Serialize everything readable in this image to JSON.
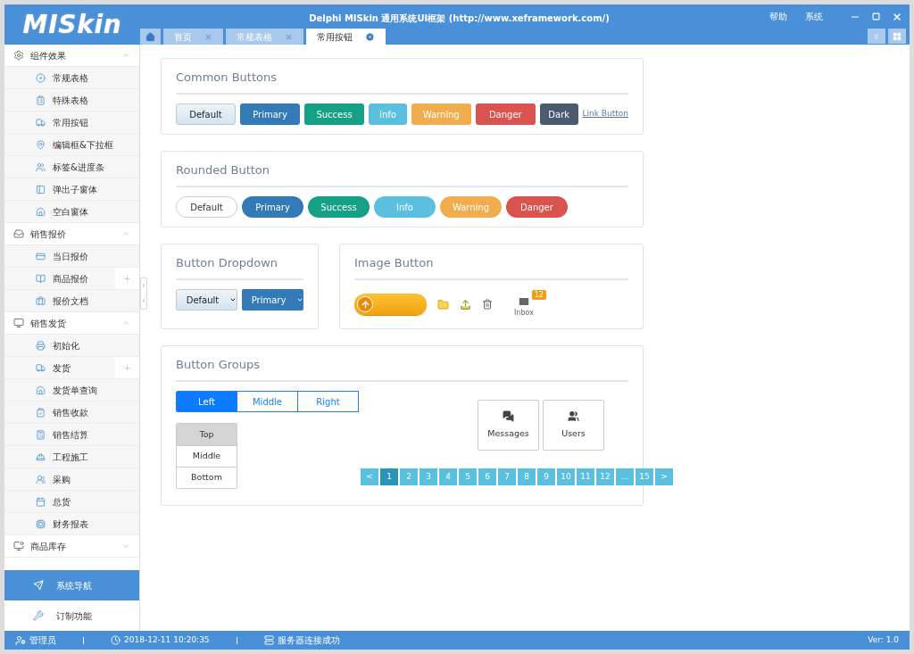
{
  "window": {
    "logo": "MISkin",
    "title": "Delphi MISkin 通用系统UI框架 (http://www.xeframework.com/)",
    "menu": [
      "帮助",
      "系统"
    ]
  },
  "tabs": [
    {
      "label": "首页",
      "selected": false
    },
    {
      "label": "常规表格",
      "selected": false
    },
    {
      "label": "常用按钮",
      "selected": true
    }
  ],
  "sidebar": {
    "groups": [
      {
        "label": "组件效果",
        "expanded": true,
        "items": [
          {
            "label": "常规表格",
            "addable": false
          },
          {
            "label": "特殊表格",
            "addable": false
          },
          {
            "label": "常用按钮",
            "addable": false
          },
          {
            "label": "编辑框&下拉框",
            "addable": false
          },
          {
            "label": "标签&进度条",
            "addable": false
          },
          {
            "label": "弹出子窗体",
            "addable": false
          },
          {
            "label": "空白窗体",
            "addable": false
          }
        ]
      },
      {
        "label": "销售报价",
        "expanded": true,
        "items": [
          {
            "label": "当日报价",
            "addable": false
          },
          {
            "label": "商品报价",
            "addable": true
          },
          {
            "label": "报价文档",
            "addable": false
          }
        ]
      },
      {
        "label": "销售发货",
        "expanded": true,
        "items": [
          {
            "label": "初始化",
            "addable": false
          },
          {
            "label": "发货",
            "addable": true
          },
          {
            "label": "发货单查询",
            "addable": false
          },
          {
            "label": "销售收款",
            "addable": false
          },
          {
            "label": "销售结算",
            "addable": false
          },
          {
            "label": "工程施工",
            "addable": false
          },
          {
            "label": "采购",
            "addable": false
          },
          {
            "label": "总货",
            "addable": false
          },
          {
            "label": "财务报表",
            "addable": false
          }
        ]
      },
      {
        "label": "商品库存",
        "expanded": false
      }
    ],
    "nav": [
      {
        "label": "系统导航",
        "selected": true
      },
      {
        "label": "订制功能",
        "selected": false
      }
    ]
  },
  "common_buttons": {
    "title": "Common Buttons",
    "buttons": [
      {
        "label": "Default",
        "kind": "default"
      },
      {
        "label": "Primary",
        "kind": "primary"
      },
      {
        "label": "Success",
        "kind": "success"
      },
      {
        "label": "Info",
        "kind": "info"
      },
      {
        "label": "Warning",
        "kind": "warning"
      },
      {
        "label": "Danger",
        "kind": "danger"
      },
      {
        "label": "Dark",
        "kind": "dark"
      },
      {
        "label": "Link Button",
        "kind": "link"
      }
    ]
  },
  "rounded_buttons": {
    "title": "Rounded Button",
    "buttons": [
      {
        "label": "Default",
        "kind": "outline"
      },
      {
        "label": "Primary",
        "kind": "primary"
      },
      {
        "label": "Success",
        "kind": "success"
      },
      {
        "label": "Info",
        "kind": "info"
      },
      {
        "label": "Warning",
        "kind": "warning"
      },
      {
        "label": "Danger",
        "kind": "danger"
      }
    ]
  },
  "button_dropdown": {
    "title": "Button Dropdown",
    "buttons": [
      {
        "label": "Default",
        "kind": "default"
      },
      {
        "label": "Primary",
        "kind": "primary"
      }
    ]
  },
  "image_button": {
    "title": "Image Button",
    "inbox": {
      "label": "Inbox",
      "count": "12"
    }
  },
  "button_groups": {
    "title": "Button Groups",
    "horizontal": [
      {
        "label": "Left",
        "selected": true
      },
      {
        "label": "Middle",
        "selected": false
      },
      {
        "label": "Right",
        "selected": false
      }
    ],
    "vertical": [
      {
        "label": "Top",
        "selected": true
      },
      {
        "label": "Middle",
        "selected": false
      },
      {
        "label": "Bottom",
        "selected": false
      }
    ],
    "tiles": [
      {
        "label": "Messages",
        "kind": "messages"
      },
      {
        "label": "Users",
        "kind": "users"
      }
    ],
    "pagination": [
      {
        "label": "<",
        "selected": false
      },
      {
        "label": "1",
        "selected": true
      },
      {
        "label": "2",
        "selected": false
      },
      {
        "label": "3",
        "selected": false
      },
      {
        "label": "4",
        "selected": false
      },
      {
        "label": "5",
        "selected": false
      },
      {
        "label": "6",
        "selected": false
      },
      {
        "label": "7",
        "selected": false
      },
      {
        "label": "8",
        "selected": false
      },
      {
        "label": "9",
        "selected": false
      },
      {
        "label": "10",
        "selected": false
      },
      {
        "label": "11",
        "selected": false
      },
      {
        "label": "12",
        "selected": false
      },
      {
        "label": "...",
        "selected": false
      },
      {
        "label": "15",
        "selected": false
      },
      {
        "label": ">",
        "selected": false
      }
    ]
  },
  "status_bar": {
    "user": "管理员",
    "time": "2018-12-11 10:20:35",
    "server": "服务器连接成功",
    "version": "Ver: 1.0"
  }
}
